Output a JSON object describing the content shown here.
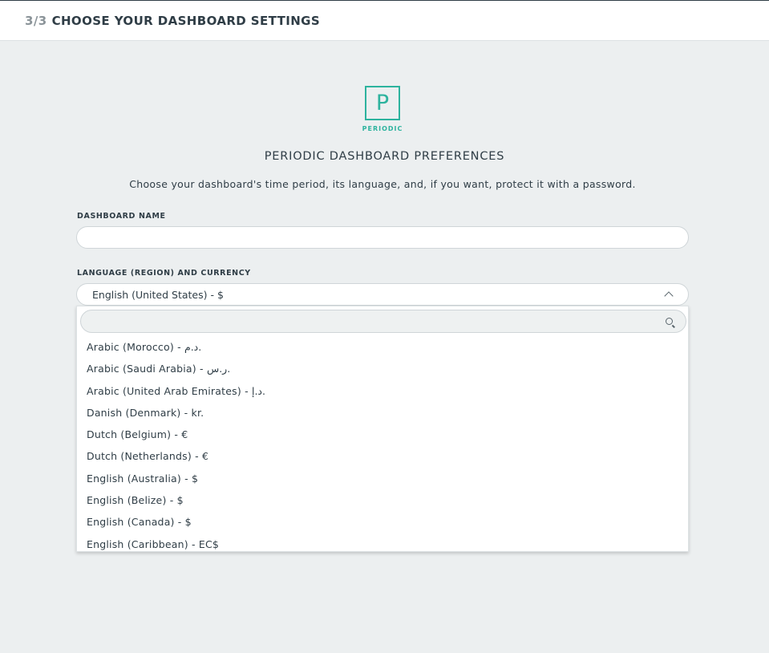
{
  "header": {
    "step": "3/3",
    "title": "CHOOSE YOUR DASHBOARD SETTINGS"
  },
  "logo": {
    "letter": "P",
    "text": "PERIODIC",
    "color": "#2db39e"
  },
  "page": {
    "heading": "PERIODIC DASHBOARD PREFERENCES",
    "description": "Choose your dashboard's time period, its language, and, if you want, protect it with a password."
  },
  "form": {
    "dashboard_name": {
      "label": "DASHBOARD NAME",
      "value": ""
    },
    "language": {
      "label": "LANGUAGE (REGION) AND CURRENCY",
      "selected": "English (United States) - $",
      "expanded": true,
      "search_value": "",
      "options": [
        "Arabic (Morocco) - د.م.",
        "Arabic (Saudi Arabia) - ر.س.",
        "Arabic (United Arab Emirates) - د.إ.",
        "Danish (Denmark) - kr.",
        "Dutch (Belgium) - €",
        "Dutch (Netherlands) - €",
        "English (Australia) - $",
        "English (Belize) - $",
        "English (Canada) - $",
        "English (Caribbean) - EC$"
      ]
    }
  }
}
